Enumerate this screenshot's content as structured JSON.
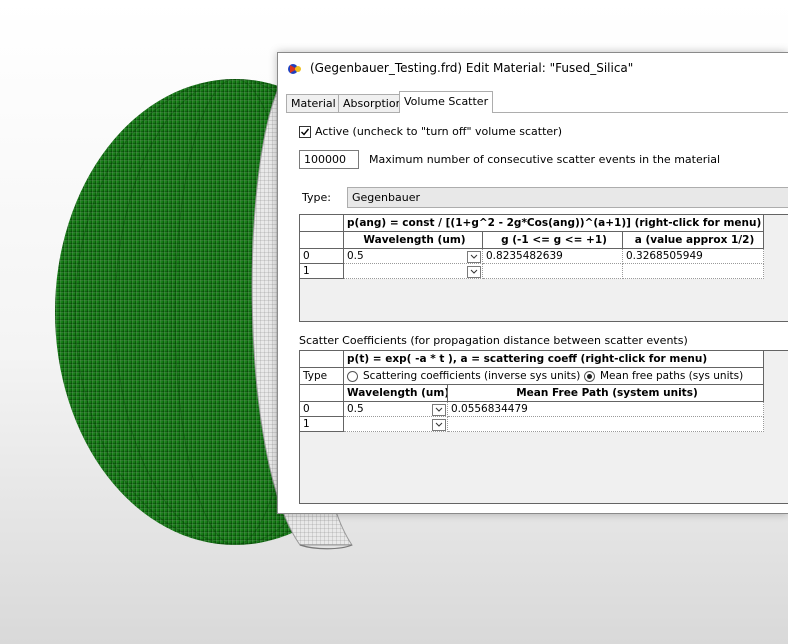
{
  "window": {
    "title": "(Gegenbauer_Testing.frd) Edit Material: \"Fused_Silica\""
  },
  "tabs": [
    {
      "label": "Material",
      "active": false
    },
    {
      "label": "Absorption",
      "active": false
    },
    {
      "label": "Volume Scatter",
      "active": true
    }
  ],
  "volume_scatter": {
    "active_label": "Active  (uncheck to \"turn off\" volume scatter)",
    "active_checked": true,
    "max_events_value": "100000",
    "max_events_label": "Maximum number of consecutive scatter events in the material",
    "type_label": "Type:",
    "type_value": "Gegenbauer"
  },
  "phase_table": {
    "formula": "p(ang) = const / [(1+g^2 - 2g*Cos(ang))^(a+1)]     (right-click for menu)",
    "columns": [
      "Wavelength (um)",
      "g   (-1 <= g <= +1)",
      "a   (value approx 1/2)"
    ],
    "rows": [
      {
        "index": "0",
        "wavelength": "0.5",
        "g": "0.8235482639",
        "a": "0.3268505949"
      },
      {
        "index": "1",
        "wavelength": "",
        "g": "",
        "a": ""
      }
    ]
  },
  "scatter_coeff": {
    "section_label": "Scatter Coefficients  (for propagation distance between scatter events)",
    "formula": "p(t) = exp( -a * t ),    a = scattering coeff     (right-click for menu)",
    "type_row_label": "Type",
    "option_coeffs": "Scattering coefficients (inverse sys units)",
    "option_mfp": "Mean free paths (sys units)",
    "selected_option": "Mean free paths (sys units)",
    "columns": [
      "Wavelength (um)",
      "Mean Free Path (system units)"
    ],
    "rows": [
      {
        "index": "0",
        "wavelength": "0.5",
        "mfp": "0.0556834479"
      },
      {
        "index": "1",
        "wavelength": "",
        "mfp": ""
      }
    ]
  },
  "colors": {
    "sphere_mesh": "#0a7a0a",
    "inner_shell": "#d8d8d8"
  }
}
